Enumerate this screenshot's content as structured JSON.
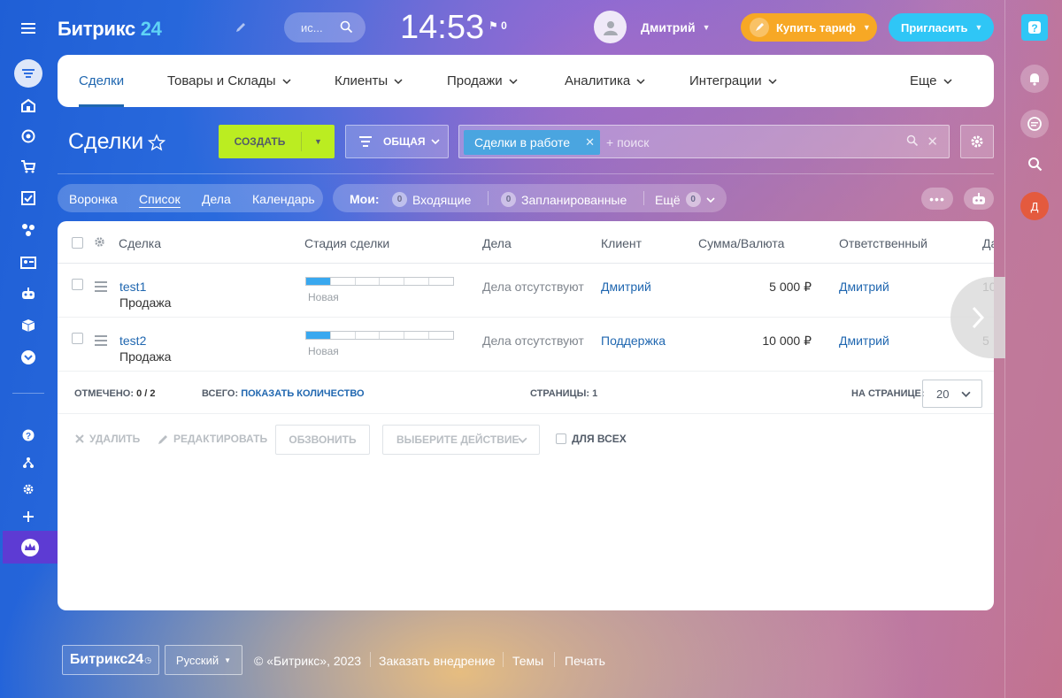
{
  "topbar": {
    "logo_main": "Битрикс",
    "logo_num": "24",
    "search_placeholder": "ис...",
    "clock": "14:53",
    "flag_count": "0",
    "user_name": "Дмитрий",
    "buy_label": "Купить тариф",
    "invite_label": "Пригласить"
  },
  "nav": {
    "items": [
      {
        "label": "Сделки"
      },
      {
        "label": "Товары и Склады"
      },
      {
        "label": "Клиенты"
      },
      {
        "label": "Продажи"
      },
      {
        "label": "Аналитика"
      },
      {
        "label": "Интеграции"
      },
      {
        "label": "Еще"
      }
    ]
  },
  "page": {
    "title": "Сделки",
    "create_label": "СОЗДАТЬ",
    "filter_label": "ОБЩАЯ",
    "filter_tag": "Сделки в работе",
    "search_placeholder": "+ поиск"
  },
  "views": {
    "items": [
      {
        "label": "Воронка"
      },
      {
        "label": "Список"
      },
      {
        "label": "Дела"
      },
      {
        "label": "Календарь"
      }
    ]
  },
  "counters": {
    "mine_label": "Мои:",
    "incoming_count": "0",
    "incoming_label": "Входящие",
    "planned_count": "0",
    "planned_label": "Запланированные",
    "more_label": "Ещё",
    "more_count": "0"
  },
  "table": {
    "headers": [
      "Сделка",
      "Стадия сделки",
      "Дела",
      "Клиент",
      "Сумма/Валюта",
      "Ответственный",
      "Да"
    ],
    "rows": [
      {
        "title": "test1",
        "type": "Продажа",
        "stage": "Новая",
        "stage_progress": 1,
        "stage_steps": 6,
        "activity": "Дела отсутствуют",
        "client": "Дмитрий",
        "amount": "5 000 ₽",
        "responsible": "Дмитрий",
        "extra": "10"
      },
      {
        "title": "test2",
        "type": "Продажа",
        "stage": "Новая",
        "stage_progress": 1,
        "stage_steps": 6,
        "activity": "Дела отсутствуют",
        "client": "Поддержка",
        "amount": "10 000 ₽",
        "responsible": "Дмитрий",
        "extra": "5"
      }
    ]
  },
  "grid_footer": {
    "selected_label": "ОТМЕЧЕНО:",
    "selected_value": "0 / 2",
    "total_label": "ВСЕГО:",
    "total_link": "ПОКАЗАТЬ КОЛИЧЕСТВО",
    "pages_label": "СТРАНИЦЫ:",
    "pages_value": "1",
    "per_page_label": "НА СТРАНИЦЕ:",
    "per_page_value": "20"
  },
  "actions": {
    "delete": "УДАЛИТЬ",
    "edit": "РЕДАКТИРОВАТЬ",
    "call": "ОБЗВОНИТЬ",
    "choose": "ВЫБЕРИТЕ ДЕЙСТВИЕ",
    "for_all": "ДЛЯ ВСЕХ"
  },
  "footer": {
    "logo": "Битрикс24",
    "lang": "Русский",
    "copyright": "© «Битрикс», 2023",
    "link1": "Заказать внедрение",
    "link2": "Темы",
    "link3": "Печать"
  },
  "right": {
    "user_initial": "Д"
  },
  "colors": {
    "create": "#bbed21",
    "buy": "#f7a825",
    "invite": "#2fc6f6",
    "link": "#2067b0",
    "stage": "#39a8ef"
  }
}
